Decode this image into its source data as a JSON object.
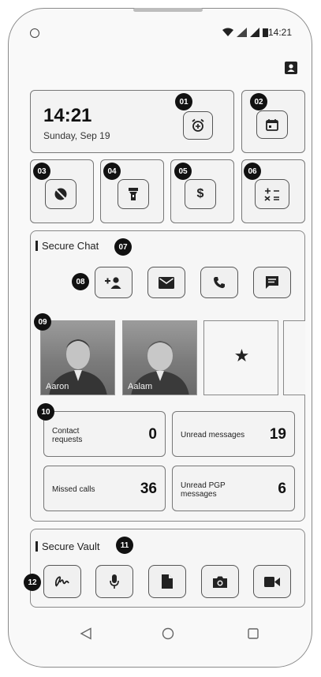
{
  "status_bar": {
    "time": "14:21",
    "icons": [
      "wifi-icon",
      "data-icon",
      "signal-icon",
      "battery-icon"
    ]
  },
  "clock_widget": {
    "time": "14:21",
    "date": "Sunday, Sep 19",
    "alarm_icon": "alarm-add-icon"
  },
  "quick_tools": {
    "icons": [
      "no-location-icon",
      "flashlight-icon",
      "currency-icon",
      "calculator-icon"
    ],
    "calendar_icon": "calendar-icon"
  },
  "secure_chat": {
    "title": "Secure Chat",
    "actions": [
      "add-contact-icon",
      "mail-icon",
      "call-icon",
      "message-icon"
    ],
    "favorites": [
      {
        "name": "Aaron"
      },
      {
        "name": "Aalam"
      }
    ],
    "stats": [
      {
        "label": "Contact requests",
        "value": "0"
      },
      {
        "label": "Unread messages",
        "value": "19"
      },
      {
        "label": "Missed calls",
        "value": "36"
      },
      {
        "label": "Unread PGP messages",
        "value": "6"
      }
    ]
  },
  "secure_vault": {
    "title": "Secure Vault",
    "actions": [
      "signature-icon",
      "microphone-icon",
      "document-icon",
      "camera-icon",
      "video-icon"
    ]
  },
  "callouts": [
    "01",
    "02",
    "03",
    "04",
    "05",
    "06",
    "07",
    "08",
    "09",
    "10",
    "11",
    "12"
  ],
  "colors": {
    "badge": "#111111",
    "border": "#777777",
    "background": "#f6f6f6"
  }
}
